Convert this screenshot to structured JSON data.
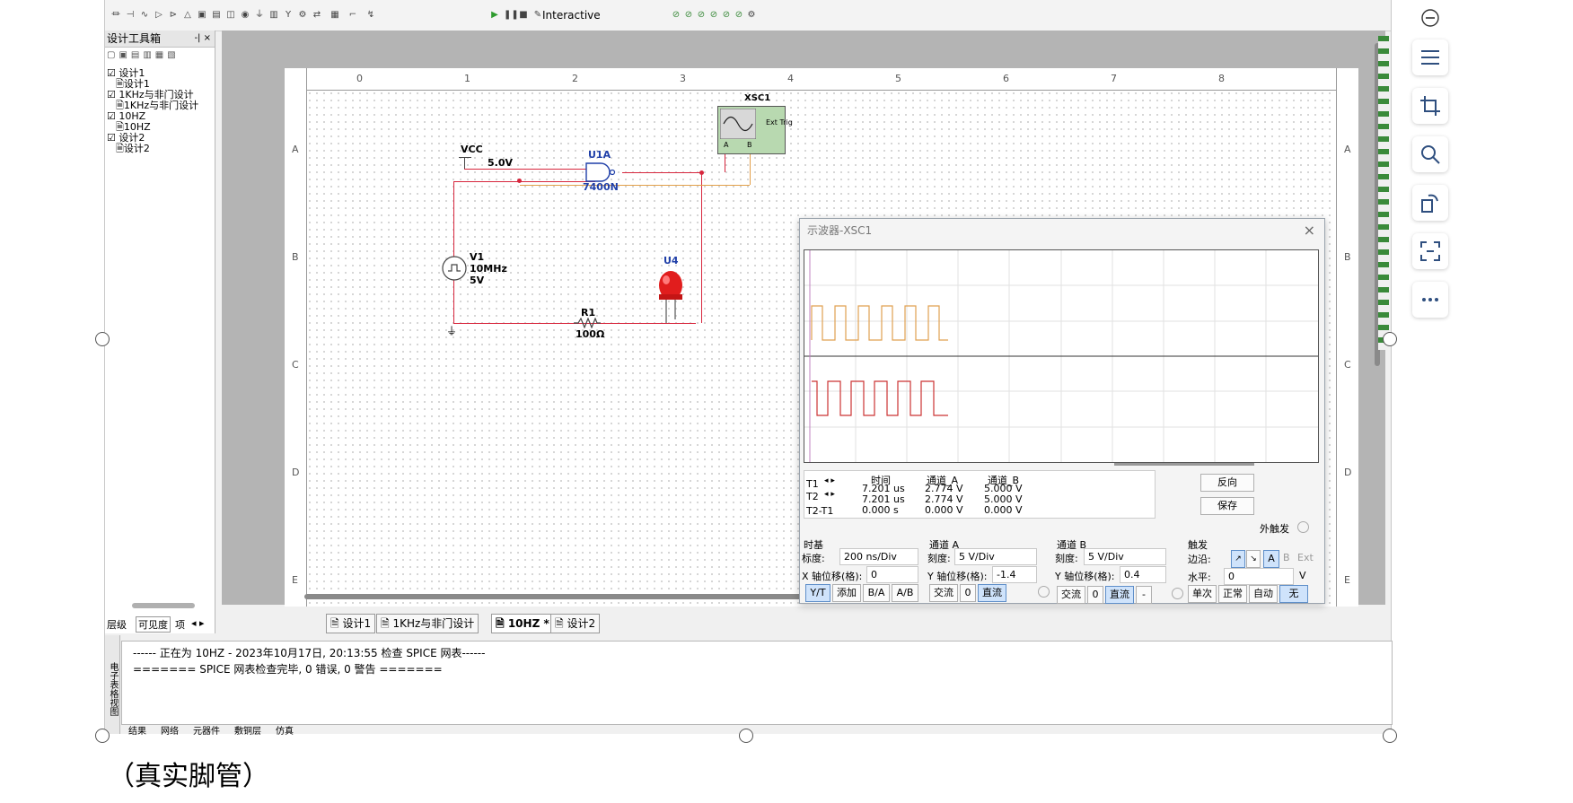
{
  "toolbar": {
    "mode_label": "Interactive"
  },
  "design_toolbox": {
    "title": "设计工具箱",
    "tree": [
      "设计1",
      "设计1",
      "1KHz与非门设计",
      "1KHz与非门设计",
      "10HZ",
      "10HZ",
      "设计2",
      "设计2"
    ],
    "bottom_tabs": [
      "层级",
      "可见度",
      "项"
    ]
  },
  "ruler": {
    "columns": [
      "0",
      "1",
      "2",
      "3",
      "4",
      "5",
      "6",
      "7",
      "8"
    ],
    "rows": [
      "A",
      "B",
      "C",
      "D",
      "E"
    ]
  },
  "circuit": {
    "vcc_label": "VCC",
    "vcc_value": "5.0V",
    "gate_name": "U1A",
    "gate_part": "7400N",
    "source_name": "V1",
    "source_freq": "10MHz",
    "source_amp": "5V",
    "resistor_name": "R1",
    "resistor_value": "100Ω",
    "led_name": "U4",
    "scope_name": "XSC1",
    "scope_ext_trig": "Ext Trig",
    "scope_pin_a": "A",
    "scope_pin_b": "B"
  },
  "oscilloscope": {
    "title": "示波器-XSC1",
    "readout_headers": [
      "时间",
      "通道_A",
      "通道_B"
    ],
    "readout_rows": [
      {
        "label": "T1",
        "time": "7.201 us",
        "a": "2.774 V",
        "b": "5.000 V"
      },
      {
        "label": "T2",
        "time": "7.201 us",
        "a": "2.774 V",
        "b": "5.000 V"
      },
      {
        "label": "T2-T1",
        "time": "0.000 s",
        "a": "0.000 V",
        "b": "0.000 V"
      }
    ],
    "reverse_button": "反向",
    "save_button": "保存",
    "ext_trigger_label": "外触发",
    "timebase": {
      "title": "时基",
      "scale_label": "标度:",
      "scale_value": "200 ns/Div",
      "xpos_label": "X 轴位移(格):",
      "xpos_value": "0",
      "buttons": [
        "Y/T",
        "添加",
        "B/A",
        "A/B"
      ]
    },
    "channel_a": {
      "title": "通道 A",
      "scale_label": "刻度:",
      "scale_value": "5  V/Div",
      "ypos_label": "Y 轴位移(格):",
      "ypos_value": "-1.4",
      "buttons": [
        "交流",
        "0",
        "直流"
      ]
    },
    "channel_b": {
      "title": "通道 B",
      "scale_label": "刻度:",
      "scale_value": "5  V/Div",
      "ypos_label": "Y 轴位移(格):",
      "ypos_value": "0.4",
      "buttons": [
        "交流",
        "0",
        "直流",
        "-"
      ]
    },
    "trigger": {
      "title": "触发",
      "edge_label": "边沿:",
      "level_label": "水平:",
      "level_value": "0",
      "level_unit": "V",
      "edge_buttons": [
        "A",
        "B",
        "Ext"
      ],
      "mode_buttons": [
        "单次",
        "正常",
        "自动",
        "无"
      ]
    }
  },
  "doc_tabs": [
    "设计1",
    "1KHz与非门设计",
    "10HZ *",
    "设计2"
  ],
  "output": {
    "lines": [
      "------ 正在为 10HZ - 2023年10月17日, 20:13:55 检查 SPICE 网表------",
      "======= SPICE 网表检查完毕, 0 错误, 0 警告 ======="
    ],
    "side_label": "电子表格视图",
    "tabs": [
      "结果",
      "网络",
      "元器件",
      "敷铜层",
      "仿真"
    ]
  },
  "caption": "（真实脚管）"
}
